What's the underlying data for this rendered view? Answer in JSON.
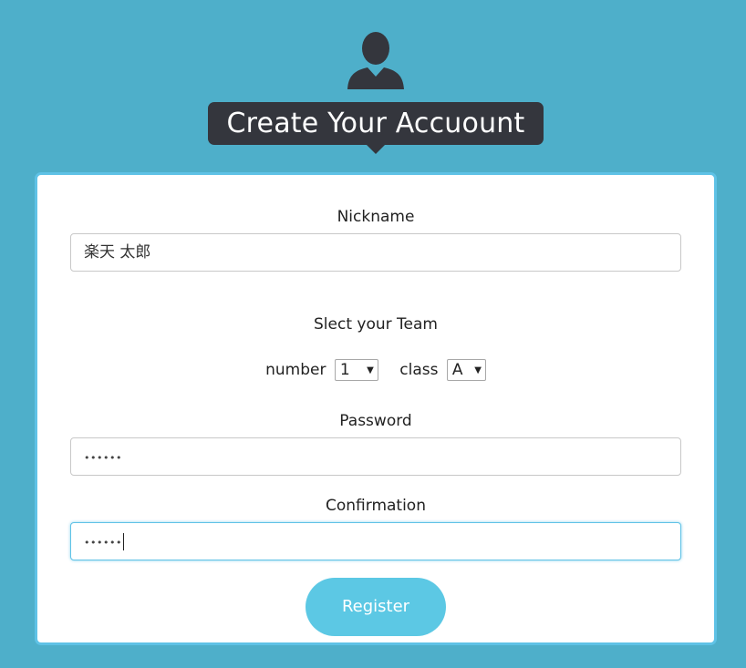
{
  "header": {
    "title": "Create Your Accuount",
    "avatar_icon": "person-silhouette-icon"
  },
  "form": {
    "nickname_label": "Nickname",
    "nickname_value": "楽天  太郎",
    "team_label": "Slect your Team",
    "number_label": "number",
    "number_value": "1",
    "class_label": "class",
    "class_value": "A",
    "password_label": "Password",
    "password_value": "••••••",
    "confirmation_label": "Confirmation",
    "confirmation_value": "••••••",
    "register_label": "Register"
  },
  "colors": {
    "background": "#4eafca",
    "title_bubble": "#34363d",
    "card_border": "#5fc2e6",
    "button": "#5cc8e4",
    "button_text": "#ffffff"
  }
}
